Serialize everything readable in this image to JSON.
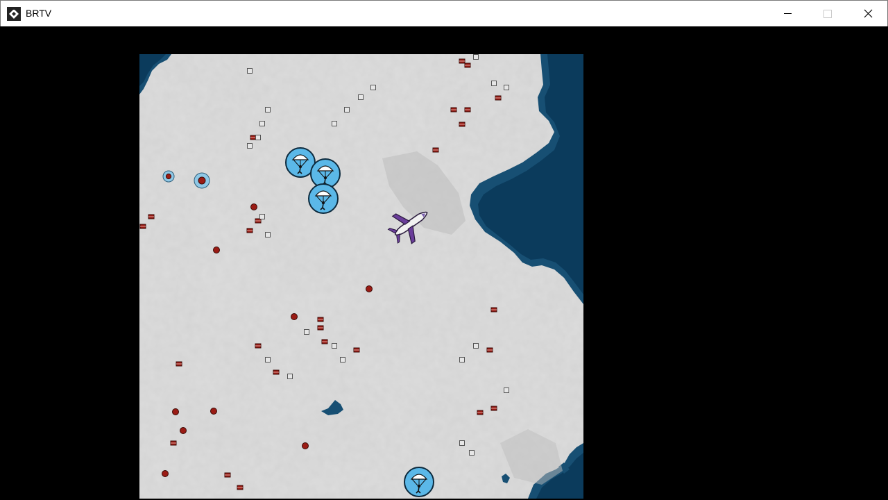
{
  "window": {
    "title": "BRTV",
    "controls": {
      "minimize": "minimize-icon",
      "maximize": "maximize-icon",
      "close": "close-icon"
    }
  },
  "colors": {
    "land_light": "#d9d9d9",
    "land_mid": "#c4c4c4",
    "land_dark": "#a9a9a9",
    "water_deep": "#0b3b5c",
    "water_edge": "#174f73",
    "parachute_blue": "#5bb8e8",
    "loot_red": "#9a1b14",
    "crate_white": "#e6e6e6",
    "plane_white": "#f2f2f2",
    "plane_purple": "#6a3d9a"
  },
  "map": {
    "icons": {
      "parachutist": "parachute-icon",
      "airplane": "airplane-icon",
      "house": "house-icon",
      "loot_dot": "loot-dot-icon",
      "crate": "crate-icon"
    }
  }
}
